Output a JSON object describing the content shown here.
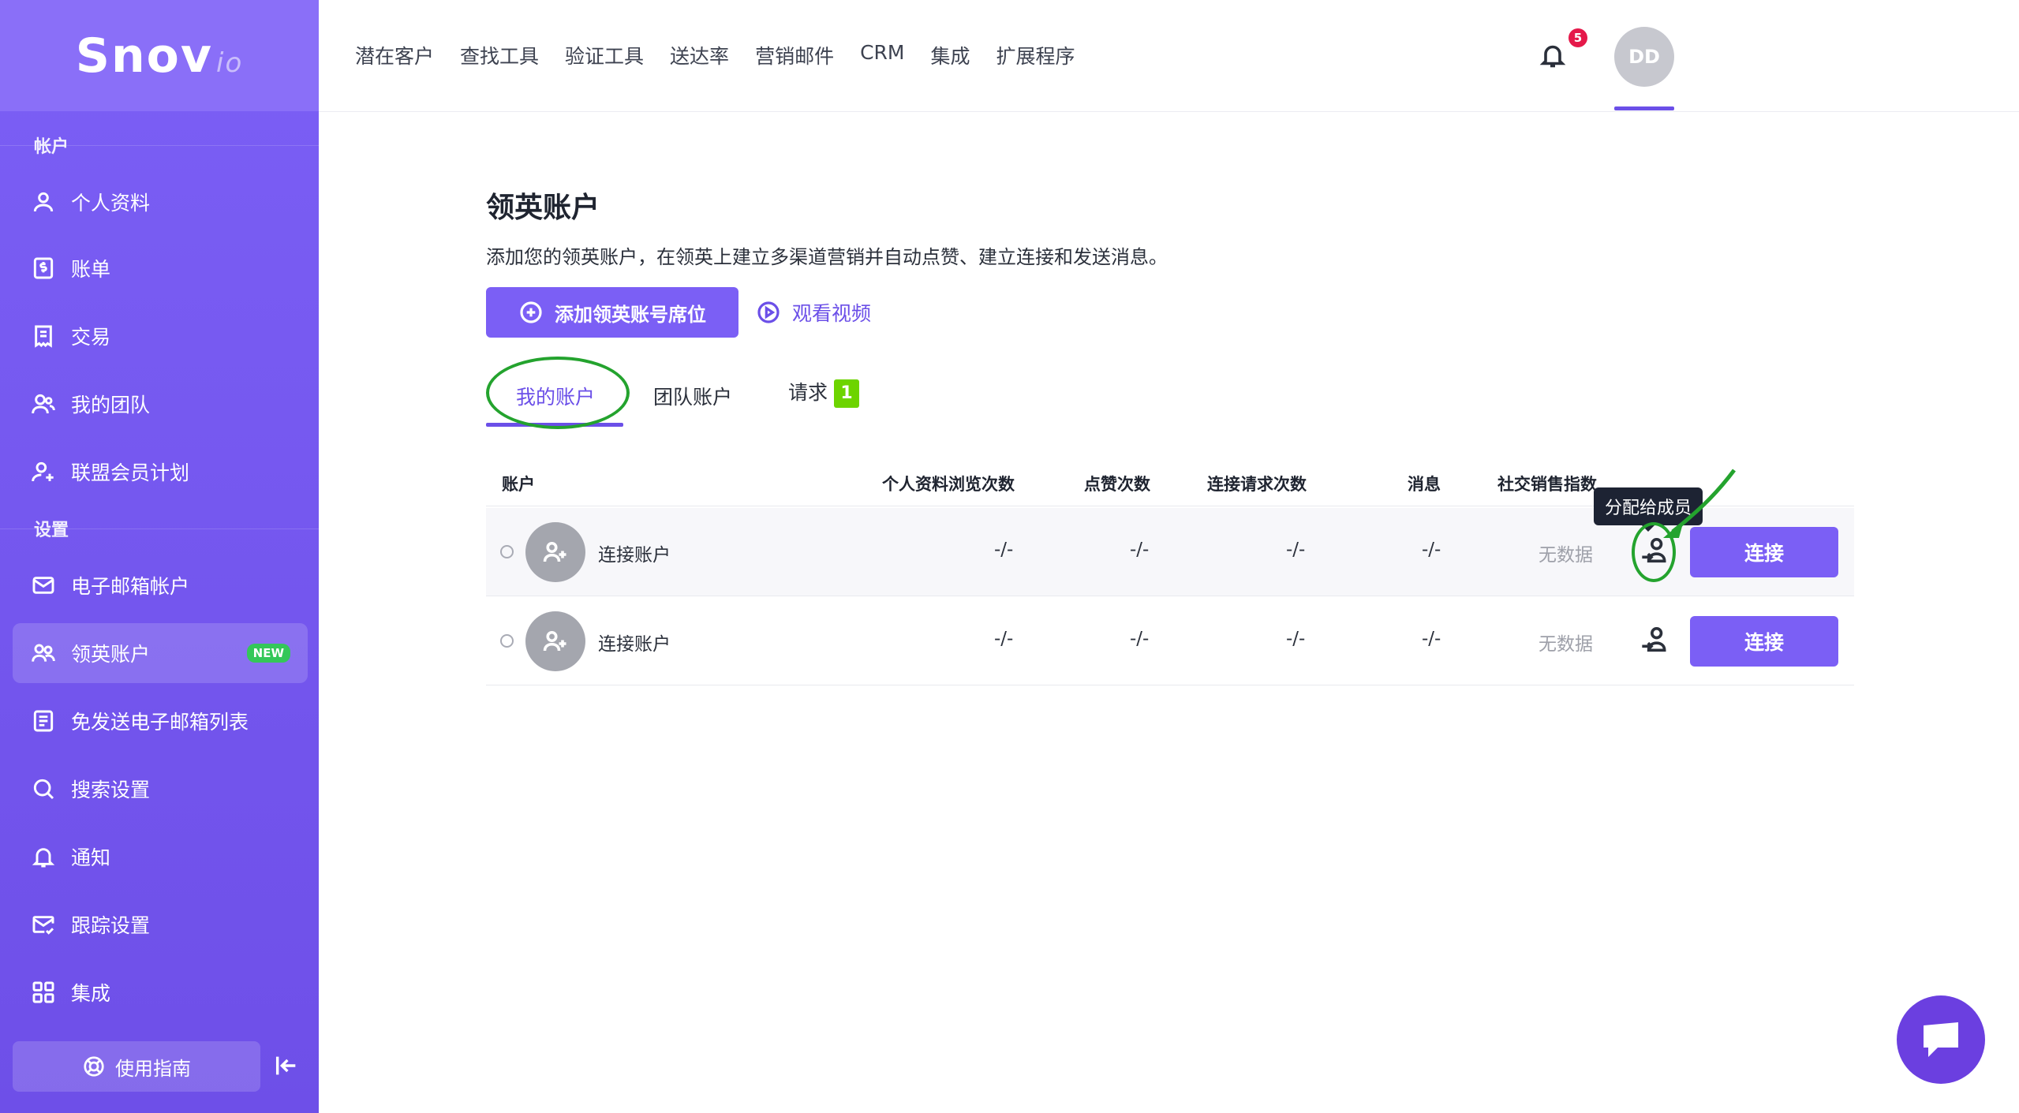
{
  "brand": {
    "logo_main": "Snov",
    "logo_suffix": "io"
  },
  "sidebar": {
    "section_account": "帐户",
    "section_settings": "设置",
    "account_items": [
      {
        "label": "个人资料",
        "icon": "user-icon"
      },
      {
        "label": "账单",
        "icon": "dollar-doc-icon"
      },
      {
        "label": "交易",
        "icon": "receipt-icon"
      },
      {
        "label": "我的团队",
        "icon": "team-icon"
      },
      {
        "label": "联盟会员计划",
        "icon": "user-plus-icon"
      }
    ],
    "settings_items": [
      {
        "label": "电子邮箱帐户",
        "icon": "mail-icon"
      },
      {
        "label": "领英账户",
        "icon": "people-icon",
        "badge": "NEW",
        "active": true
      },
      {
        "label": "免发送电子邮箱列表",
        "icon": "list-doc-icon"
      },
      {
        "label": "搜索设置",
        "icon": "search-icon"
      },
      {
        "label": "通知",
        "icon": "bell-icon"
      },
      {
        "label": "跟踪设置",
        "icon": "mail-track-icon"
      },
      {
        "label": "集成",
        "icon": "grid-icon"
      }
    ],
    "guide_label": "使用指南"
  },
  "topnav": {
    "items": [
      "潜在客户",
      "查找工具",
      "验证工具",
      "送达率",
      "营销邮件",
      "CRM",
      "集成",
      "扩展程序"
    ],
    "notification_count": "5",
    "avatar_initials": "DD"
  },
  "main": {
    "title": "领英账户",
    "description": "添加您的领英账户，在领英上建立多渠道营销并自动点赞、建立连接和发送消息。",
    "add_button": "添加领英账号席位",
    "video_link": "观看视频",
    "tabs": [
      {
        "label": "我的账户",
        "active": true
      },
      {
        "label": "团队账户"
      },
      {
        "label": "请求",
        "count": "1"
      }
    ],
    "columns": [
      "账户",
      "个人资料浏览次数",
      "点赞次数",
      "连接请求次数",
      "消息",
      "社交销售指数"
    ],
    "rows": [
      {
        "name": "连接账户",
        "views": "-/-",
        "likes": "-/-",
        "requests": "-/-",
        "messages": "-/-",
        "ssi": "无数据",
        "action": "连接"
      },
      {
        "name": "连接账户",
        "views": "-/-",
        "likes": "-/-",
        "requests": "-/-",
        "messages": "-/-",
        "ssi": "无数据",
        "action": "连接"
      }
    ],
    "tooltip": "分配给成员"
  },
  "colors": {
    "accent": "#7b5ff5",
    "annotation": "#24a32e",
    "badge_new": "#34c759",
    "tab_count": "#6dd400"
  }
}
